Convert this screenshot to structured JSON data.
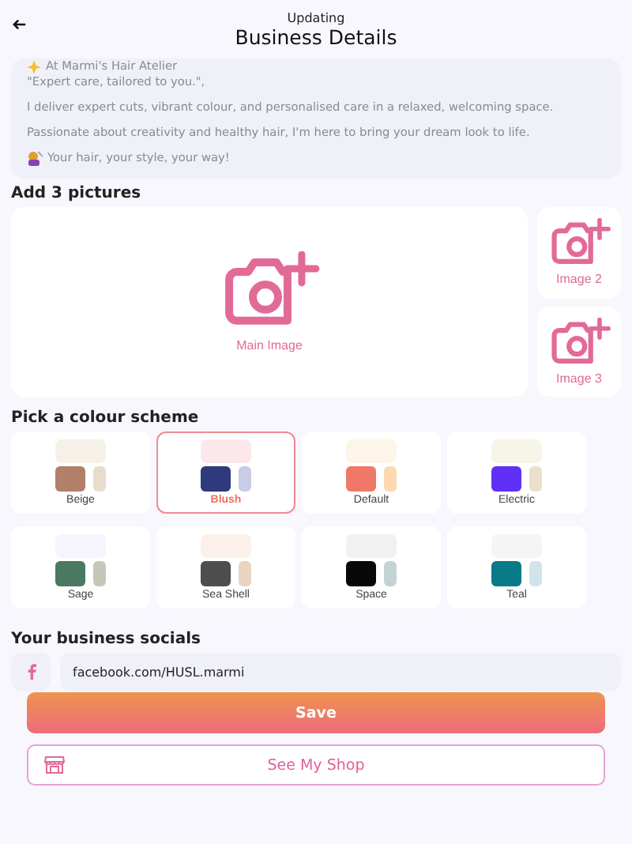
{
  "header": {
    "subtitle": "Updating",
    "title": "Business Details"
  },
  "description": {
    "lines": [
      "At Marmi's Hair Atelier",
      "\"Expert care, tailored to you.\",",
      "I deliver expert cuts, vibrant colour, and personalised care in a relaxed, welcoming space.",
      "Passionate about creativity and healthy hair, I'm here to bring your dream look to life.",
      "Your hair, your style, your way!"
    ]
  },
  "pictures": {
    "heading": "Add 3 pictures",
    "main": "Main Image",
    "others": [
      "Image 2",
      "Image 3"
    ]
  },
  "colour_schemes": {
    "heading": "Pick a colour scheme",
    "items": [
      {
        "name": "Beige",
        "selected": false,
        "swatches": [
          {
            "color": "#f6f1e8"
          },
          {
            "color": "#b08068"
          },
          {
            "color": "#e8dccc"
          }
        ]
      },
      {
        "name": "Blush",
        "selected": true,
        "swatches": [
          {
            "color": "#fce8ea"
          },
          {
            "color": "#2e3a7c"
          },
          {
            "color": "#c8cce4"
          }
        ]
      },
      {
        "name": "Default",
        "selected": false,
        "swatches": [
          {
            "color": "#fdf5e8"
          },
          {
            "color": "#f07868"
          },
          {
            "color": "#fdd8b0"
          }
        ]
      },
      {
        "name": "Electric",
        "selected": false,
        "swatches": [
          {
            "color": "#f7f5e8"
          },
          {
            "color": "#6030f8"
          },
          {
            "color": "#e8e0c8"
          }
        ]
      },
      {
        "name": "Sage",
        "selected": false,
        "swatches": [
          {
            "color": "#f5f6fd"
          },
          {
            "color": "#4a7860"
          },
          {
            "color": "#c4c8b8"
          }
        ]
      },
      {
        "name": "Sea Shell",
        "selected": false,
        "swatches": [
          {
            "color": "#fcf1ea"
          },
          {
            "color": "#4e4e4e"
          },
          {
            "color": "#e8d4c0"
          }
        ]
      },
      {
        "name": "Space",
        "selected": false,
        "swatches": [
          {
            "color": "#f0f2f2"
          },
          {
            "color": "#080808"
          },
          {
            "color": "#c4d4d6"
          }
        ]
      },
      {
        "name": "Teal",
        "selected": false,
        "swatches": [
          {
            "color": "#f4f5f6"
          },
          {
            "color": "#087a88"
          },
          {
            "color": "#d0e4ea"
          }
        ]
      }
    ]
  },
  "socials": {
    "heading": "Your business socials",
    "items": [
      {
        "kind": "facebook",
        "value": "facebook.com/HUSL.marmi"
      }
    ]
  },
  "buttons": {
    "save": "Save",
    "shop": "See My Shop"
  }
}
